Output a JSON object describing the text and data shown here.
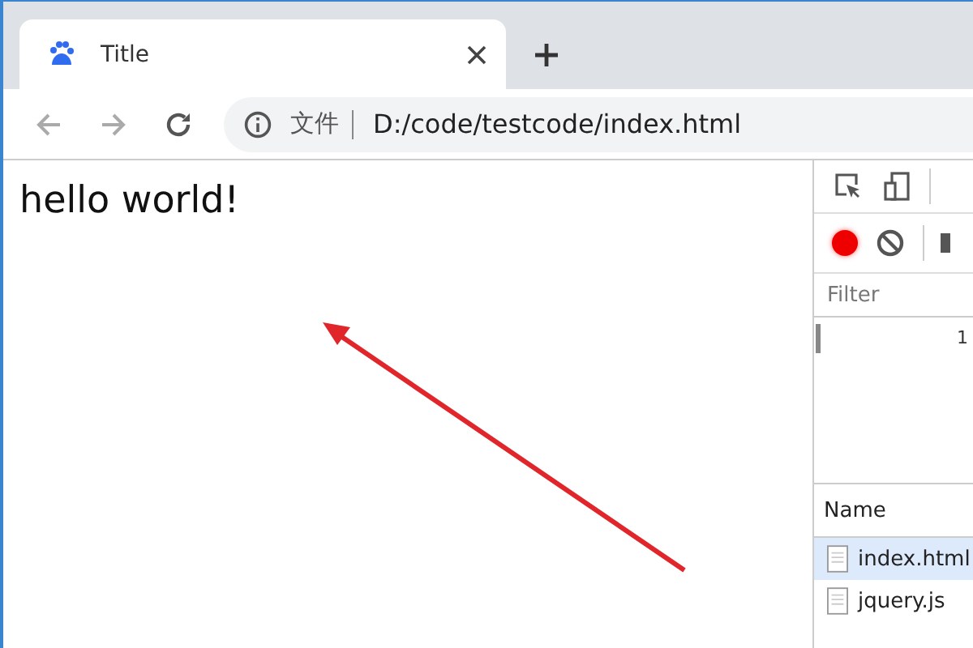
{
  "tabs": [
    {
      "title": "Title",
      "selected": true
    }
  ],
  "toolbar": {
    "address_label": "文件",
    "address": "D:/code/testcode/index.html"
  },
  "page": {
    "heading": "hello world!"
  },
  "devtools": {
    "recording": true,
    "filter": {
      "placeholder": "Filter"
    },
    "timeline_tick": "1",
    "columns": [
      "Name"
    ],
    "requests": [
      {
        "name": "index.html",
        "selected": true
      },
      {
        "name": "jquery.js",
        "selected": false
      }
    ]
  }
}
